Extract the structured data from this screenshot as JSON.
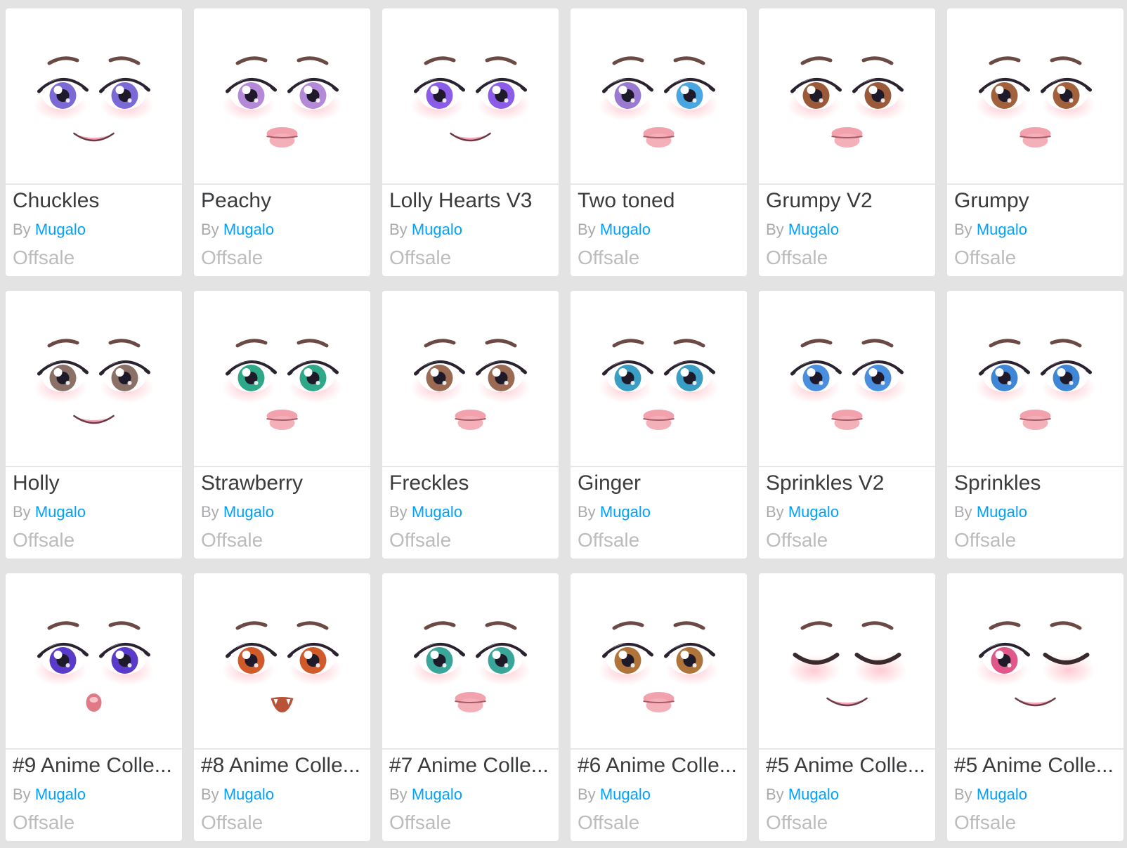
{
  "by_prefix": "By",
  "colors": {
    "link": "#00a2ff",
    "offsale": "#bcbcbc",
    "name": "#393b3d",
    "background": "#e3e3e3"
  },
  "items": [
    {
      "name": "Chuckles",
      "creator": "Mugalo",
      "price": "Offsale",
      "icon": "face-thumbnail-icon",
      "iris": "#7b6ad6",
      "iris2": "#7b6ad6",
      "mouth": "smile"
    },
    {
      "name": "Peachy",
      "creator": "Mugalo",
      "price": "Offsale",
      "icon": "face-thumbnail-icon",
      "iris": "#b48ad8",
      "iris2": "#b48ad8",
      "mouth": "lips"
    },
    {
      "name": "Lolly Hearts V3",
      "creator": "Mugalo",
      "price": "Offsale",
      "icon": "face-thumbnail-icon",
      "iris": "#8a5ce8",
      "iris2": "#8a5ce8",
      "mouth": "smile"
    },
    {
      "name": "Two toned",
      "creator": "Mugalo",
      "price": "Offsale",
      "icon": "face-thumbnail-icon",
      "iris": "#9a7ad0",
      "iris2": "#4aa6e0",
      "mouth": "lips"
    },
    {
      "name": "Grumpy V2",
      "creator": "Mugalo",
      "price": "Offsale",
      "icon": "face-thumbnail-icon",
      "iris": "#9a5a3a",
      "iris2": "#9a5a3a",
      "mouth": "lips"
    },
    {
      "name": "Grumpy",
      "creator": "Mugalo",
      "price": "Offsale",
      "icon": "face-thumbnail-icon",
      "iris": "#a0613c",
      "iris2": "#a0613c",
      "mouth": "lips"
    },
    {
      "name": "Holly",
      "creator": "Mugalo",
      "price": "Offsale",
      "icon": "face-thumbnail-icon",
      "iris": "#8a7066",
      "iris2": "#8a7066",
      "mouth": "smile"
    },
    {
      "name": "Strawberry",
      "creator": "Mugalo",
      "price": "Offsale",
      "icon": "face-thumbnail-icon",
      "iris": "#2fa88a",
      "iris2": "#2fa88a",
      "mouth": "lips"
    },
    {
      "name": "Freckles",
      "creator": "Mugalo",
      "price": "Offsale",
      "icon": "face-thumbnail-icon",
      "iris": "#9a6a52",
      "iris2": "#9a6a52",
      "mouth": "lips"
    },
    {
      "name": "Ginger",
      "creator": "Mugalo",
      "price": "Offsale",
      "icon": "face-thumbnail-icon",
      "iris": "#3a9ec4",
      "iris2": "#3a9ec4",
      "mouth": "lips"
    },
    {
      "name": "Sprinkles V2",
      "creator": "Mugalo",
      "price": "Offsale",
      "icon": "face-thumbnail-icon",
      "iris": "#4a8ee0",
      "iris2": "#4a8ee0",
      "mouth": "lips"
    },
    {
      "name": "Sprinkles",
      "creator": "Mugalo",
      "price": "Offsale",
      "icon": "face-thumbnail-icon",
      "iris": "#3f86d6",
      "iris2": "#3f86d6",
      "mouth": "lips"
    },
    {
      "name": "#9 Anime Colle...",
      "creator": "Mugalo",
      "price": "Offsale",
      "icon": "face-thumbnail-icon",
      "iris": "#5a3ac8",
      "iris2": "#5a3ac8",
      "mouth": "o"
    },
    {
      "name": "#8 Anime Colle...",
      "creator": "Mugalo",
      "price": "Offsale",
      "icon": "face-thumbnail-icon",
      "iris": "#d05a2a",
      "iris2": "#d05a2a",
      "mouth": "fang"
    },
    {
      "name": "#7 Anime Colle...",
      "creator": "Mugalo",
      "price": "Offsale",
      "icon": "face-thumbnail-icon",
      "iris": "#3aa69a",
      "iris2": "#3aa69a",
      "mouth": "lips"
    },
    {
      "name": "#6 Anime Colle...",
      "creator": "Mugalo",
      "price": "Offsale",
      "icon": "face-thumbnail-icon",
      "iris": "#b0743a",
      "iris2": "#b0743a",
      "mouth": "lips"
    },
    {
      "name": "#5 Anime Colle...",
      "creator": "Mugalo",
      "price": "Offsale",
      "icon": "face-thumbnail-icon",
      "iris": "#000000",
      "iris2": "#000000",
      "mouth": "smile",
      "closed": "both"
    },
    {
      "name": "#5 Anime Colle...",
      "creator": "Mugalo",
      "price": "Offsale",
      "icon": "face-thumbnail-icon",
      "iris": "#e0578a",
      "iris2": "#e0578a",
      "mouth": "smile",
      "closed": "right"
    }
  ]
}
